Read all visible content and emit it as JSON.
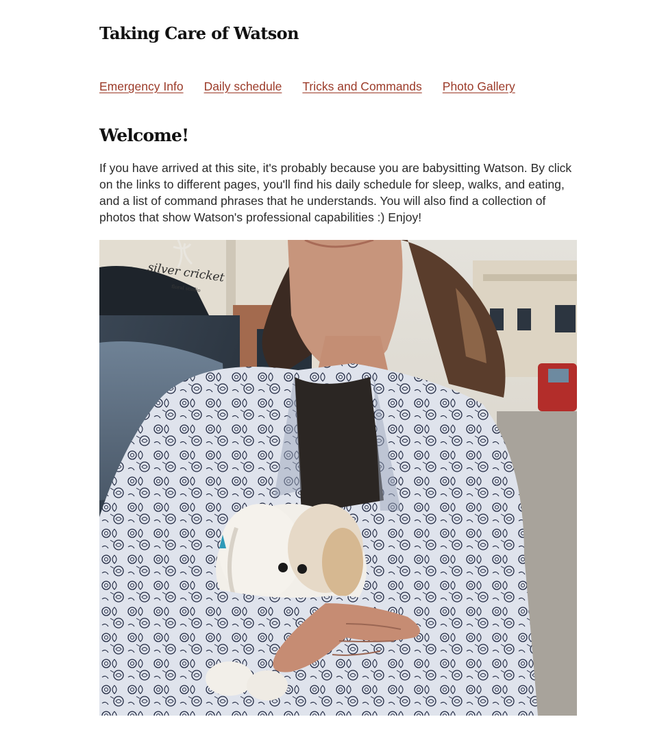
{
  "site": {
    "title": "Taking Care of Watson"
  },
  "nav": {
    "links": [
      {
        "label": "Emergency Info"
      },
      {
        "label": "Daily schedule"
      },
      {
        "label": "Tricks and Commands"
      },
      {
        "label": "Photo Gallery"
      }
    ],
    "link_color": "#9b3a28"
  },
  "main": {
    "heading": "Welcome!",
    "intro": "If you have arrived at this site, it's probably because you are babysitting Watson. By click on the links to different pages, you'll find his daily schedule for sleep, walks, and eating, and a list of command phrases that he understands. You will also find a collection of photos that show Watson's professional capabilities :) Enjoy!",
    "photo": {
      "storefront_sign": "silver cricket",
      "storefront_subtext": "floral studio"
    }
  }
}
